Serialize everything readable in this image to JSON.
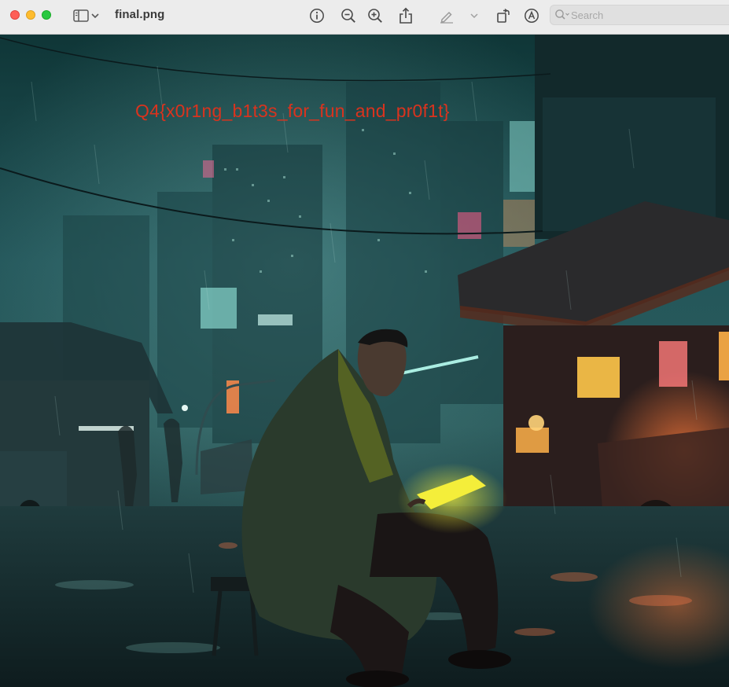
{
  "window": {
    "title": "final.png",
    "controls": [
      "close",
      "minimize",
      "zoom"
    ]
  },
  "toolbar": {
    "buttons": [
      {
        "name": "sidebar-toggle",
        "icon": "sidebar-icon"
      },
      {
        "name": "sidebar-menu",
        "icon": "chevron-down-icon"
      },
      {
        "name": "info",
        "icon": "info-icon"
      },
      {
        "name": "zoom-out",
        "icon": "zoom-out-icon"
      },
      {
        "name": "zoom-in",
        "icon": "zoom-in-icon"
      },
      {
        "name": "share",
        "icon": "share-icon"
      },
      {
        "name": "markup",
        "icon": "pencil-icon"
      },
      {
        "name": "markup-menu",
        "icon": "chevron-down-icon"
      },
      {
        "name": "rotate",
        "icon": "rotate-icon"
      },
      {
        "name": "annotate",
        "icon": "markup-pen-icon"
      }
    ],
    "search": {
      "placeholder": "Search",
      "value": ""
    }
  },
  "image": {
    "overlay_text": "Q4{x0r1ng_b1t3s_for_fun_and_pr0f1t}"
  },
  "colors": {
    "traffic_close": "#fe5f57",
    "traffic_min": "#febc2e",
    "traffic_max": "#28c840",
    "overlay_text": "#d9331e",
    "sky": "#1b4a4a",
    "neon_orange": "#ff7a3a",
    "neon_yellow": "#f4ee3a"
  }
}
